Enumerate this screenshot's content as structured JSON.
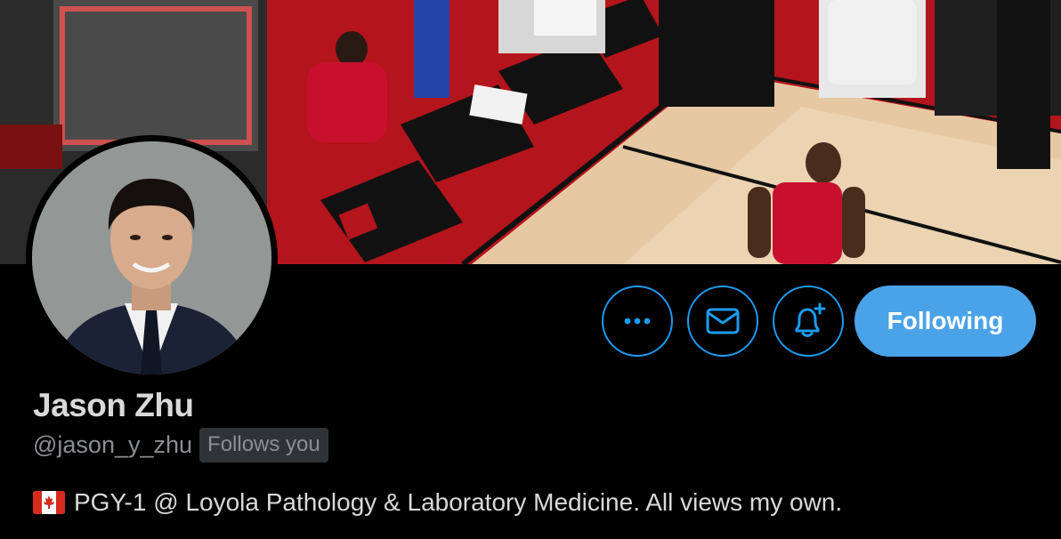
{
  "profile": {
    "name": "Jason Zhu",
    "handle": "@jason_y_zhu",
    "follows_you_badge": "Follows you",
    "bio_text": "PGY-1 @ Loyola Pathology & Laboratory Medicine. All views my own.",
    "bio_flag_icon": "canada-flag-icon"
  },
  "actions": {
    "more_icon": "more-dots-icon",
    "message_icon": "envelope-icon",
    "notify_icon": "bell-plus-icon",
    "follow_label": "Following"
  },
  "colors": {
    "background": "#000000",
    "accent": "#1d9bf0",
    "following_button": "#4aa3e8",
    "primary_text": "#d9d9d9",
    "secondary_text": "#8b8f93",
    "badge_bg": "#2f3336"
  }
}
